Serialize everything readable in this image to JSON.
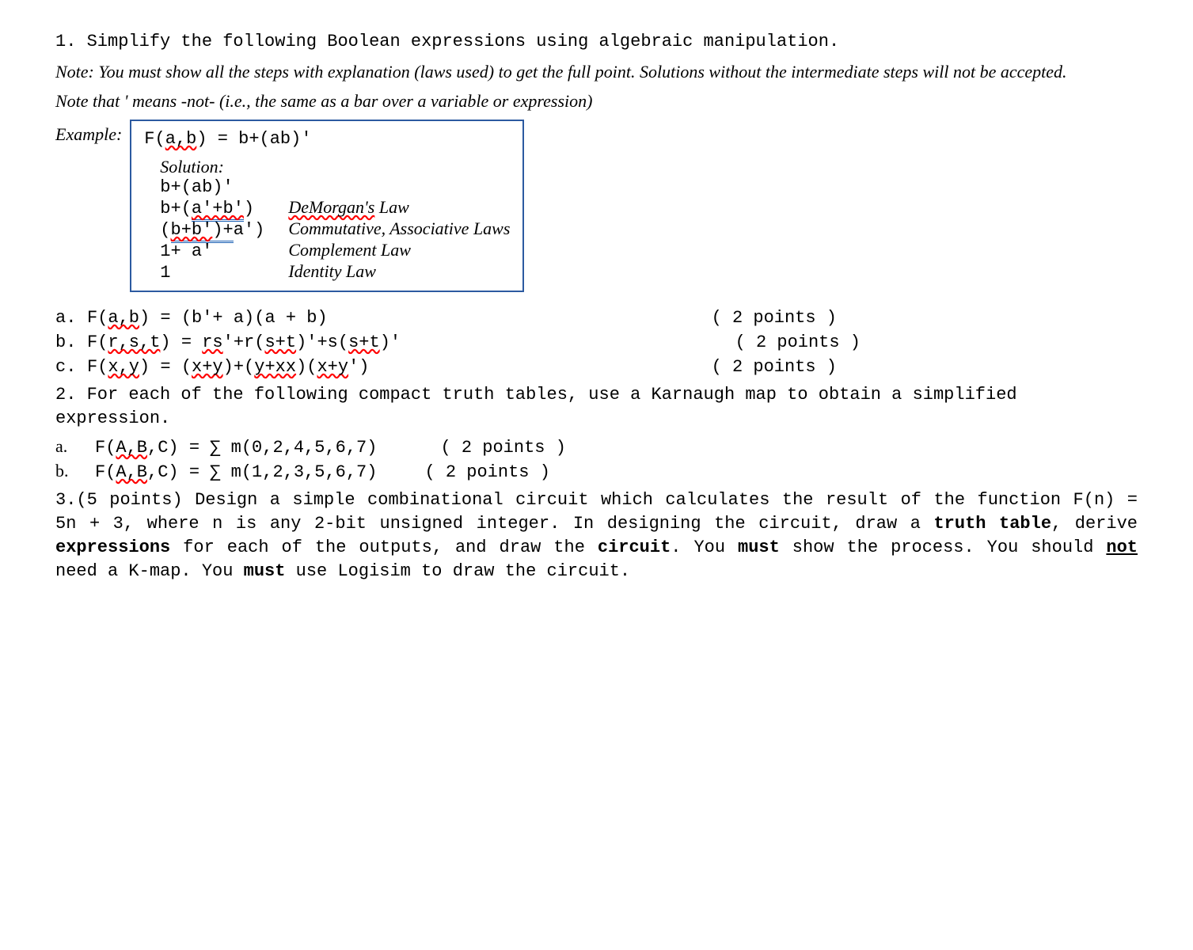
{
  "q1": {
    "stem": "1.   Simplify the following Boolean expressions using algebraic manipulation.",
    "note1": "Note: You must show all the steps with explanation (laws used) to get the full point. Solutions without the intermediate steps will not be accepted.",
    "note2": "Note that ' means -not- (i.e., the same as a bar over a variable or expression)",
    "example_label": "Example:",
    "example_expr_pre": "F(",
    "example_expr_ab": "a,b",
    "example_expr_post": ") = b+(ab)'",
    "solution_label": "Solution:",
    "sol_line1": "b+(ab)'",
    "sol_line2_pre": "b+(",
    "sol_line2_mid": "a'+b'",
    "sol_line2_post": ")",
    "sol_law2_pre": "DeMorgan's",
    "sol_law2_post": " Law",
    "sol_line3_pre": "(",
    "sol_line3_mid1": "b+b'",
    "sol_line3_mid2": ")+",
    "sol_line3_post": "a')",
    "sol_law3": "Commutative, Associative Laws",
    "sol_line4": "1+ a'",
    "sol_law4": "Complement Law",
    "sol_line5": "1",
    "sol_law5": "Identity Law",
    "parts": {
      "a": {
        "label": "a.",
        "pre": "F(",
        "sq1": "a,b",
        "mid": ") = (b'+ a)(a + b)",
        "pts": "( 2 points )"
      },
      "b": {
        "label": "b.",
        "pre": "F(",
        "sq1": "r,s,t",
        "m1": ") = ",
        "sq2": "rs",
        "m2": "'+r(",
        "sq3": "s+t",
        "m3": ")'+s(",
        "sq4": "s+t",
        "m4": ")'",
        "pts": "( 2 points )"
      },
      "c": {
        "label": "c.",
        "pre": "F(",
        "sq1": "x,y",
        "m1": ") = (",
        "sq2": "x+y",
        "m2": ")+(",
        "sq3": "y+xx",
        "m3": ")(",
        "sq4": "x+y",
        "m4": "')",
        "pts": "( 2 points )"
      }
    }
  },
  "q2": {
    "stem": "2. For each of the following compact truth tables, use a Karnaugh map to obtain a simplified expression.",
    "parts": {
      "a": {
        "label": "a.",
        "pre": "F(",
        "sq": "A,B",
        "post": ",C) = ∑ m(0,2,4,5,6,7)",
        "pts": "( 2 points )"
      },
      "b": {
        "label": "b.",
        "pre": "F(",
        "sq": "A,B",
        "post": ",C) = ∑ m(1,2,3,5,6,7)",
        "pts": "( 2 points )"
      }
    }
  },
  "q3": {
    "t1": "3.(5 points) Design a simple combinational circuit which calculates the result of the function F(n) = 5n + 3, where n is any 2-bit unsigned integer. In designing the circuit, draw a ",
    "b1": "truth table",
    "t2": ", derive ",
    "b2": "expressions",
    "t3": " for each of the outputs, and draw the ",
    "b3": "circuit",
    "t4": ". You ",
    "b4": "must",
    "t5": " show the process. You should ",
    "b5": "not",
    "t6": " need a K-map. You ",
    "b6": "must",
    "t7": " use Logisim to draw the circuit."
  }
}
